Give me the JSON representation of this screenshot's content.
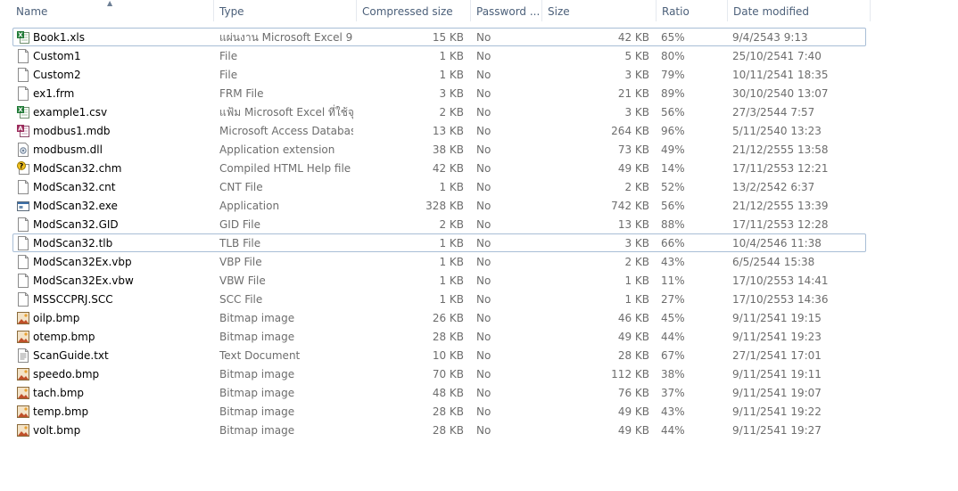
{
  "columns": {
    "name": "Name",
    "type": "Type",
    "compressed_size": "Compressed size",
    "password": "Password ...",
    "size": "Size",
    "ratio": "Ratio",
    "date_modified": "Date modified"
  },
  "files": [
    {
      "name": "Book1.xls",
      "type": "แผ่นงาน Microsoft Excel 9...",
      "compressed": "15 KB",
      "password": "No",
      "size": "42 KB",
      "ratio": "65%",
      "date": "9/4/2543 9:13",
      "icon": "excel-icon",
      "selected": true
    },
    {
      "name": "Custom1",
      "type": "File",
      "compressed": "1 KB",
      "password": "No",
      "size": "5 KB",
      "ratio": "80%",
      "date": "25/10/2541 7:40",
      "icon": "blank-file-icon"
    },
    {
      "name": "Custom2",
      "type": "File",
      "compressed": "1 KB",
      "password": "No",
      "size": "3 KB",
      "ratio": "79%",
      "date": "10/11/2541 18:35",
      "icon": "blank-file-icon"
    },
    {
      "name": "ex1.frm",
      "type": "FRM File",
      "compressed": "3 KB",
      "password": "No",
      "size": "21 KB",
      "ratio": "89%",
      "date": "30/10/2540 13:07",
      "icon": "blank-file-icon"
    },
    {
      "name": "example1.csv",
      "type": "แฟ้ม Microsoft Excel ที่ใช้จุ...",
      "compressed": "2 KB",
      "password": "No",
      "size": "3 KB",
      "ratio": "56%",
      "date": "27/3/2544 7:57",
      "icon": "excel-icon"
    },
    {
      "name": "modbus1.mdb",
      "type": "Microsoft Access Database",
      "compressed": "13 KB",
      "password": "No",
      "size": "264 KB",
      "ratio": "96%",
      "date": "5/11/2540 13:23",
      "icon": "access-icon"
    },
    {
      "name": "modbusm.dll",
      "type": "Application extension",
      "compressed": "38 KB",
      "password": "No",
      "size": "73 KB",
      "ratio": "49%",
      "date": "21/12/2555 13:58",
      "icon": "dll-icon"
    },
    {
      "name": "ModScan32.chm",
      "type": "Compiled HTML Help file",
      "compressed": "42 KB",
      "password": "No",
      "size": "49 KB",
      "ratio": "14%",
      "date": "17/11/2553 12:21",
      "icon": "help-icon"
    },
    {
      "name": "ModScan32.cnt",
      "type": "CNT File",
      "compressed": "1 KB",
      "password": "No",
      "size": "2 KB",
      "ratio": "52%",
      "date": "13/2/2542 6:37",
      "icon": "blank-file-icon"
    },
    {
      "name": "ModScan32.exe",
      "type": "Application",
      "compressed": "328 KB",
      "password": "No",
      "size": "742 KB",
      "ratio": "56%",
      "date": "21/12/2555 13:39",
      "icon": "exe-icon"
    },
    {
      "name": "ModScan32.GID",
      "type": "GID File",
      "compressed": "2 KB",
      "password": "No",
      "size": "13 KB",
      "ratio": "88%",
      "date": "17/11/2553 12:28",
      "icon": "blank-file-icon"
    },
    {
      "name": "ModScan32.tlb",
      "type": "TLB File",
      "compressed": "1 KB",
      "password": "No",
      "size": "3 KB",
      "ratio": "66%",
      "date": "10/4/2546 11:38",
      "icon": "blank-file-icon",
      "selected": true
    },
    {
      "name": "ModScan32Ex.vbp",
      "type": "VBP File",
      "compressed": "1 KB",
      "password": "No",
      "size": "2 KB",
      "ratio": "43%",
      "date": "6/5/2544 15:38",
      "icon": "blank-file-icon"
    },
    {
      "name": "ModScan32Ex.vbw",
      "type": "VBW File",
      "compressed": "1 KB",
      "password": "No",
      "size": "1 KB",
      "ratio": "11%",
      "date": "17/10/2553 14:41",
      "icon": "blank-file-icon"
    },
    {
      "name": "MSSCCPRJ.SCC",
      "type": "SCC File",
      "compressed": "1 KB",
      "password": "No",
      "size": "1 KB",
      "ratio": "27%",
      "date": "17/10/2553 14:36",
      "icon": "blank-file-icon"
    },
    {
      "name": "oilp.bmp",
      "type": "Bitmap image",
      "compressed": "26 KB",
      "password": "No",
      "size": "46 KB",
      "ratio": "45%",
      "date": "9/11/2541 19:15",
      "icon": "bitmap-icon"
    },
    {
      "name": "otemp.bmp",
      "type": "Bitmap image",
      "compressed": "28 KB",
      "password": "No",
      "size": "49 KB",
      "ratio": "44%",
      "date": "9/11/2541 19:23",
      "icon": "bitmap-icon"
    },
    {
      "name": "ScanGuide.txt",
      "type": "Text Document",
      "compressed": "10 KB",
      "password": "No",
      "size": "28 KB",
      "ratio": "67%",
      "date": "27/1/2541 17:01",
      "icon": "text-file-icon"
    },
    {
      "name": "speedo.bmp",
      "type": "Bitmap image",
      "compressed": "70 KB",
      "password": "No",
      "size": "112 KB",
      "ratio": "38%",
      "date": "9/11/2541 19:11",
      "icon": "bitmap-icon"
    },
    {
      "name": "tach.bmp",
      "type": "Bitmap image",
      "compressed": "48 KB",
      "password": "No",
      "size": "76 KB",
      "ratio": "37%",
      "date": "9/11/2541 19:07",
      "icon": "bitmap-icon"
    },
    {
      "name": "temp.bmp",
      "type": "Bitmap image",
      "compressed": "28 KB",
      "password": "No",
      "size": "49 KB",
      "ratio": "43%",
      "date": "9/11/2541 19:22",
      "icon": "bitmap-icon"
    },
    {
      "name": "volt.bmp",
      "type": "Bitmap image",
      "compressed": "28 KB",
      "password": "No",
      "size": "49 KB",
      "ratio": "44%",
      "date": "9/11/2541 19:27",
      "icon": "bitmap-icon"
    }
  ]
}
